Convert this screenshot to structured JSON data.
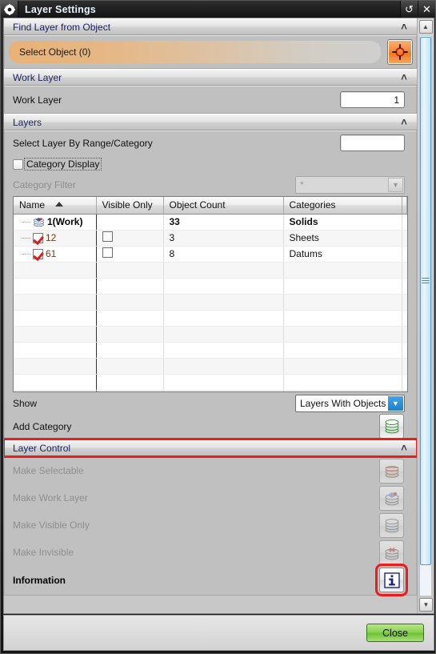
{
  "titlebar": {
    "title": "Layer Settings",
    "gear_icon": "gear-icon",
    "reset_icon": "reset-arrow-icon",
    "close_icon": "close-x-icon",
    "reset_glyph": "↺",
    "close_glyph": "✕"
  },
  "sections": {
    "find_layer": {
      "title": "Find Layer from Object",
      "chevron": "˄"
    },
    "work_layer": {
      "title": "Work Layer",
      "chevron": "˄"
    },
    "layers": {
      "title": "Layers",
      "chevron": "˄"
    },
    "layer_control": {
      "title": "Layer Control",
      "chevron": "˄",
      "highlight_color": "#ec1c1c"
    }
  },
  "find_layer": {
    "select_object_label": "Select Object (0)",
    "select_object_icon": "crosshair-target-icon"
  },
  "work_layer": {
    "label": "Work Layer",
    "value": "1"
  },
  "layers": {
    "select_by_range_label": "Select Layer By Range/Category",
    "select_by_range_value": "",
    "category_display_label": "Category Display",
    "category_display_checked": false,
    "category_filter_label": "Category Filter",
    "category_filter_value": "*",
    "category_filter_enabled": false,
    "show_label": "Show",
    "show_value": "Layers With Objects",
    "add_category_label": "Add Category",
    "add_category_icon": "green-layer-stack-icon"
  },
  "table": {
    "columns": [
      "Name",
      "Visible Only",
      "Object Count",
      "Categories"
    ],
    "sort_column": "Name",
    "sort_direction": "ascending",
    "rows": [
      {
        "name": "1(Work)",
        "icon": "layer-stack-work-icon",
        "visible_only": null,
        "object_count": "33",
        "categories": "Solids",
        "is_work": true
      },
      {
        "name": "12",
        "icon": "red-check-icon",
        "visible_only": false,
        "object_count": "3",
        "categories": "Sheets",
        "is_work": false
      },
      {
        "name": "61",
        "icon": "red-check-icon",
        "visible_only": false,
        "object_count": "8",
        "categories": "Datums",
        "is_work": false
      }
    ],
    "empty_row_count": 9
  },
  "layer_control": {
    "items": [
      {
        "label": "Make Selectable",
        "icon": "layer-selectable-icon",
        "enabled": false,
        "highlight": false
      },
      {
        "label": "Make Work Layer",
        "icon": "layer-work-icon",
        "enabled": false,
        "highlight": false
      },
      {
        "label": "Make Visible Only",
        "icon": "layer-visible-icon",
        "enabled": false,
        "highlight": false
      },
      {
        "label": "Make Invisible",
        "icon": "layer-invisible-icon",
        "enabled": false,
        "highlight": false
      },
      {
        "label": "Information",
        "icon": "information-i-icon",
        "enabled": true,
        "highlight": true
      }
    ]
  },
  "scrollbar": {
    "up_icon": "scroll-up-arrow-icon",
    "down_icon": "scroll-down-arrow-icon",
    "up_glyph": "▲",
    "down_glyph": "▼",
    "grip_icon": "scroll-grip-icon"
  },
  "footer": {
    "close_label": "Close"
  }
}
